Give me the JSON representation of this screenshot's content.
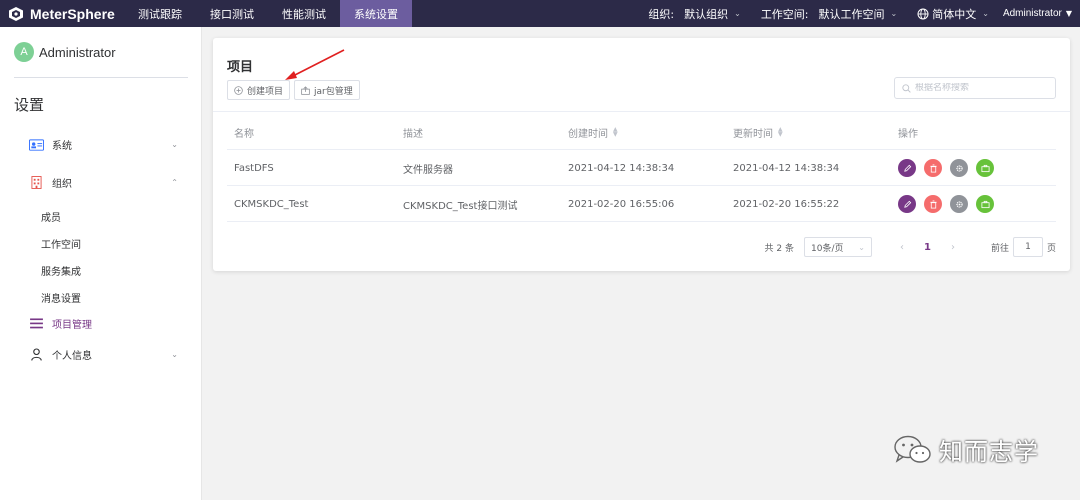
{
  "app": {
    "logo_text": "MeterSphere",
    "accent": "#783887",
    "topbar_color": "#2c2a48",
    "active_tab_color": "#6c5d9f"
  },
  "nav": {
    "tabs": [
      {
        "label": "测试跟踪"
      },
      {
        "label": "接口测试"
      },
      {
        "label": "性能测试"
      },
      {
        "label": "系统设置",
        "active": true
      }
    ]
  },
  "topbar": {
    "org_label": "组织:",
    "org_value": "默认组织",
    "workspace_label": "工作空间:",
    "workspace_value": "默认工作空间",
    "language": "简体中文",
    "user": "Administrator"
  },
  "sidebar": {
    "avatar_letter": "A",
    "user_name": "Administrator",
    "section_title": "设置",
    "menu": {
      "system": "系统",
      "org": "组织",
      "org_sub": [
        "成员",
        "工作空间",
        "服务集成",
        "消息设置"
      ],
      "project": "项目管理",
      "personal": "个人信息"
    }
  },
  "main": {
    "title": "项目",
    "create_button": "创建项目",
    "jar_button": "jar包管理",
    "search_placeholder": "根据名称搜索",
    "table": {
      "headers": {
        "name": "名称",
        "description": "描述",
        "created": "创建时间",
        "updated": "更新时间",
        "actions": "操作"
      },
      "rows": [
        {
          "name": "FastDFS",
          "description": "文件服务器",
          "created": "2021-04-12 14:38:34",
          "updated": "2021-04-12 14:38:34"
        },
        {
          "name": "CKMSKDC_Test",
          "description": "CKMSKDC_Test接口测试",
          "created": "2021-02-20 16:55:06",
          "updated": "2021-02-20 16:55:22"
        }
      ],
      "action_colors": [
        "#783887",
        "#f56c6c",
        "#909399",
        "#67c23a"
      ]
    },
    "pagination": {
      "total": "共 2 条",
      "page_size": "10条/页",
      "current_page": "1",
      "goto_label": "前往",
      "goto_value": "1",
      "page_suffix": "页"
    }
  },
  "watermark": {
    "text": "知而志学"
  }
}
